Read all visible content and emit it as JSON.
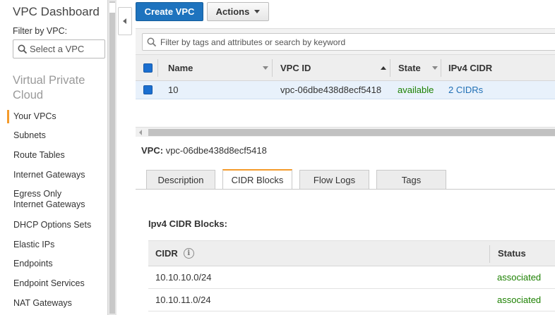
{
  "sidebar": {
    "title": "VPC Dashboard",
    "filter_label": "Filter by VPC:",
    "filter_placeholder": "Select a VPC",
    "section": "Virtual Private Cloud",
    "items": [
      {
        "label": "Your VPCs",
        "active": true
      },
      {
        "label": "Subnets"
      },
      {
        "label": "Route Tables"
      },
      {
        "label": "Internet Gateways"
      },
      {
        "label": "Egress Only Internet Gateways"
      },
      {
        "label": "DHCP Options Sets"
      },
      {
        "label": "Elastic IPs"
      },
      {
        "label": "Endpoints"
      },
      {
        "label": "Endpoint Services"
      },
      {
        "label": "NAT Gateways"
      }
    ]
  },
  "toolbar": {
    "create_label": "Create VPC",
    "actions_label": "Actions"
  },
  "search": {
    "placeholder": "Filter by tags and attributes or search by keyword"
  },
  "table": {
    "columns": [
      "Name",
      "VPC ID",
      "State",
      "IPv4 CIDR"
    ],
    "rows": [
      {
        "name": "10",
        "vpc_id": "vpc-06dbe438d8ecf5418",
        "state": "available",
        "cidr": "2 CIDRs"
      }
    ]
  },
  "detail": {
    "vpc_label": "VPC:",
    "vpc_value": "vpc-06dbe438d8ecf5418",
    "tabs": [
      "Description",
      "CIDR Blocks",
      "Flow Logs",
      "Tags"
    ],
    "active_tab": "CIDR Blocks",
    "section_title": "Ipv4 CIDR Blocks:",
    "cidr_columns": [
      "CIDR",
      "Status"
    ],
    "cidr_rows": [
      {
        "cidr": "10.10.10.0/24",
        "status": "associated"
      },
      {
        "cidr": "10.10.11.0/24",
        "status": "associated"
      }
    ]
  },
  "colors": {
    "primary_button": "#1e73be",
    "active_accent": "#f49b2b",
    "status_green": "#1d8102",
    "link_blue": "#1f6fb5",
    "selected_row": "#e8f1fb"
  }
}
